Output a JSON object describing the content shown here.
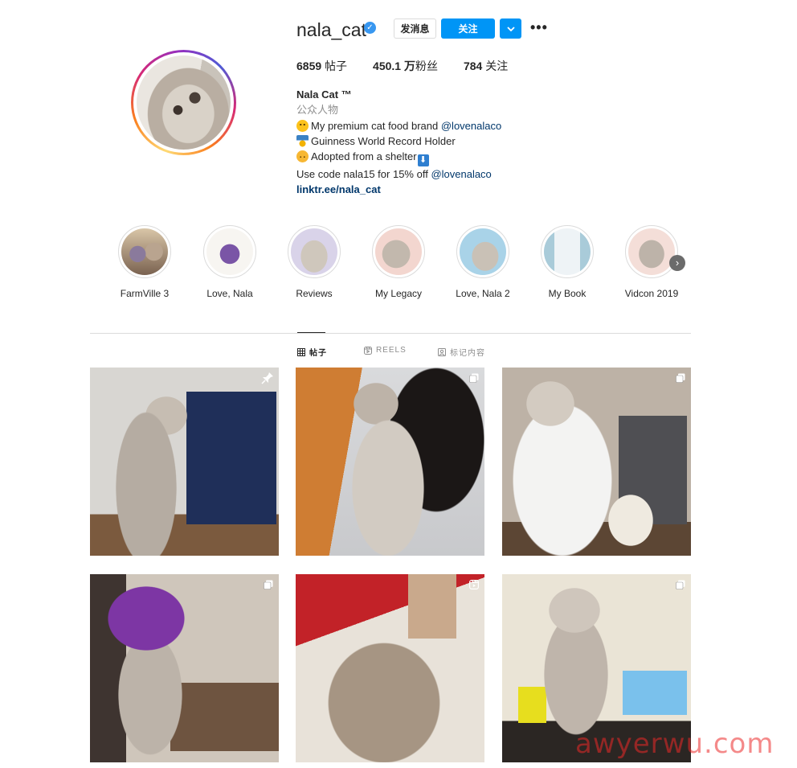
{
  "profile": {
    "username": "nala_cat",
    "message_label": "发消息",
    "follow_label": "关注",
    "stats": {
      "posts": {
        "value": "6859",
        "label": " 帖子"
      },
      "followers": {
        "value": "450.1 万",
        "label": "粉丝"
      },
      "following": {
        "value": "784",
        "label": " 关注"
      }
    },
    "bio": {
      "name": "Nala Cat ™",
      "category": "公众人物",
      "line1_text": "My premium cat food brand ",
      "line1_handle": "@lovenalaco",
      "line2_text": "Guinness World Record Holder",
      "line3_text": "Adopted from a shelter",
      "line4_text": "Use code nala15 for 15% off ",
      "line4_handle": "@lovenalaco",
      "url": "linktr.ee/nala_cat"
    }
  },
  "highlights": [
    {
      "label": "FarmVille 3"
    },
    {
      "label": "Love, Nala"
    },
    {
      "label": "Reviews"
    },
    {
      "label": "My Legacy"
    },
    {
      "label": "Love, Nala 2"
    },
    {
      "label": "My Book"
    },
    {
      "label": "Vidcon 2019"
    }
  ],
  "tabs": {
    "posts": "帖子",
    "reels": "REELS",
    "tagged": "标记内容"
  },
  "posts": [
    {
      "type": "pinned-icon"
    },
    {
      "type": "multi-photo-icon"
    },
    {
      "type": "multi-photo-icon"
    },
    {
      "type": "multi-photo-icon"
    },
    {
      "type": "reel-icon"
    },
    {
      "type": "multi-photo-icon"
    }
  ],
  "watermark": "awyerwu.com",
  "colors": {
    "accent": "#0095f6",
    "link": "#00376b",
    "verified": "#3897f0"
  }
}
